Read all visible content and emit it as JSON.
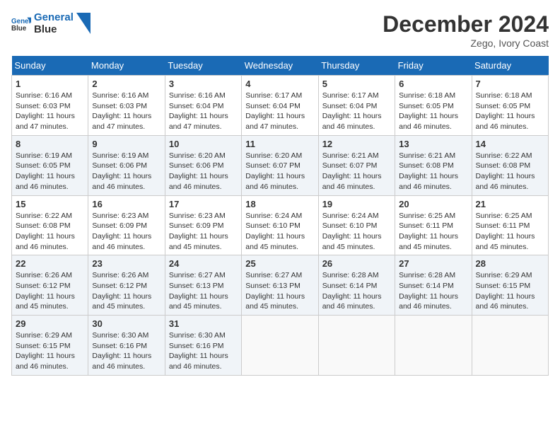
{
  "header": {
    "logo_line1": "General",
    "logo_line2": "Blue",
    "month": "December 2024",
    "location": "Zego, Ivory Coast"
  },
  "days_of_week": [
    "Sunday",
    "Monday",
    "Tuesday",
    "Wednesday",
    "Thursday",
    "Friday",
    "Saturday"
  ],
  "weeks": [
    [
      {
        "day": "1",
        "sunrise": "6:16 AM",
        "sunset": "6:03 PM",
        "daylight": "11 hours and 47 minutes."
      },
      {
        "day": "2",
        "sunrise": "6:16 AM",
        "sunset": "6:03 PM",
        "daylight": "11 hours and 47 minutes."
      },
      {
        "day": "3",
        "sunrise": "6:16 AM",
        "sunset": "6:04 PM",
        "daylight": "11 hours and 47 minutes."
      },
      {
        "day": "4",
        "sunrise": "6:17 AM",
        "sunset": "6:04 PM",
        "daylight": "11 hours and 47 minutes."
      },
      {
        "day": "5",
        "sunrise": "6:17 AM",
        "sunset": "6:04 PM",
        "daylight": "11 hours and 46 minutes."
      },
      {
        "day": "6",
        "sunrise": "6:18 AM",
        "sunset": "6:05 PM",
        "daylight": "11 hours and 46 minutes."
      },
      {
        "day": "7",
        "sunrise": "6:18 AM",
        "sunset": "6:05 PM",
        "daylight": "11 hours and 46 minutes."
      }
    ],
    [
      {
        "day": "8",
        "sunrise": "6:19 AM",
        "sunset": "6:05 PM",
        "daylight": "11 hours and 46 minutes."
      },
      {
        "day": "9",
        "sunrise": "6:19 AM",
        "sunset": "6:06 PM",
        "daylight": "11 hours and 46 minutes."
      },
      {
        "day": "10",
        "sunrise": "6:20 AM",
        "sunset": "6:06 PM",
        "daylight": "11 hours and 46 minutes."
      },
      {
        "day": "11",
        "sunrise": "6:20 AM",
        "sunset": "6:07 PM",
        "daylight": "11 hours and 46 minutes."
      },
      {
        "day": "12",
        "sunrise": "6:21 AM",
        "sunset": "6:07 PM",
        "daylight": "11 hours and 46 minutes."
      },
      {
        "day": "13",
        "sunrise": "6:21 AM",
        "sunset": "6:08 PM",
        "daylight": "11 hours and 46 minutes."
      },
      {
        "day": "14",
        "sunrise": "6:22 AM",
        "sunset": "6:08 PM",
        "daylight": "11 hours and 46 minutes."
      }
    ],
    [
      {
        "day": "15",
        "sunrise": "6:22 AM",
        "sunset": "6:08 PM",
        "daylight": "11 hours and 46 minutes."
      },
      {
        "day": "16",
        "sunrise": "6:23 AM",
        "sunset": "6:09 PM",
        "daylight": "11 hours and 46 minutes."
      },
      {
        "day": "17",
        "sunrise": "6:23 AM",
        "sunset": "6:09 PM",
        "daylight": "11 hours and 45 minutes."
      },
      {
        "day": "18",
        "sunrise": "6:24 AM",
        "sunset": "6:10 PM",
        "daylight": "11 hours and 45 minutes."
      },
      {
        "day": "19",
        "sunrise": "6:24 AM",
        "sunset": "6:10 PM",
        "daylight": "11 hours and 45 minutes."
      },
      {
        "day": "20",
        "sunrise": "6:25 AM",
        "sunset": "6:11 PM",
        "daylight": "11 hours and 45 minutes."
      },
      {
        "day": "21",
        "sunrise": "6:25 AM",
        "sunset": "6:11 PM",
        "daylight": "11 hours and 45 minutes."
      }
    ],
    [
      {
        "day": "22",
        "sunrise": "6:26 AM",
        "sunset": "6:12 PM",
        "daylight": "11 hours and 45 minutes."
      },
      {
        "day": "23",
        "sunrise": "6:26 AM",
        "sunset": "6:12 PM",
        "daylight": "11 hours and 45 minutes."
      },
      {
        "day": "24",
        "sunrise": "6:27 AM",
        "sunset": "6:13 PM",
        "daylight": "11 hours and 45 minutes."
      },
      {
        "day": "25",
        "sunrise": "6:27 AM",
        "sunset": "6:13 PM",
        "daylight": "11 hours and 45 minutes."
      },
      {
        "day": "26",
        "sunrise": "6:28 AM",
        "sunset": "6:14 PM",
        "daylight": "11 hours and 46 minutes."
      },
      {
        "day": "27",
        "sunrise": "6:28 AM",
        "sunset": "6:14 PM",
        "daylight": "11 hours and 46 minutes."
      },
      {
        "day": "28",
        "sunrise": "6:29 AM",
        "sunset": "6:15 PM",
        "daylight": "11 hours and 46 minutes."
      }
    ],
    [
      {
        "day": "29",
        "sunrise": "6:29 AM",
        "sunset": "6:15 PM",
        "daylight": "11 hours and 46 minutes."
      },
      {
        "day": "30",
        "sunrise": "6:30 AM",
        "sunset": "6:16 PM",
        "daylight": "11 hours and 46 minutes."
      },
      {
        "day": "31",
        "sunrise": "6:30 AM",
        "sunset": "6:16 PM",
        "daylight": "11 hours and 46 minutes."
      },
      null,
      null,
      null,
      null
    ]
  ]
}
